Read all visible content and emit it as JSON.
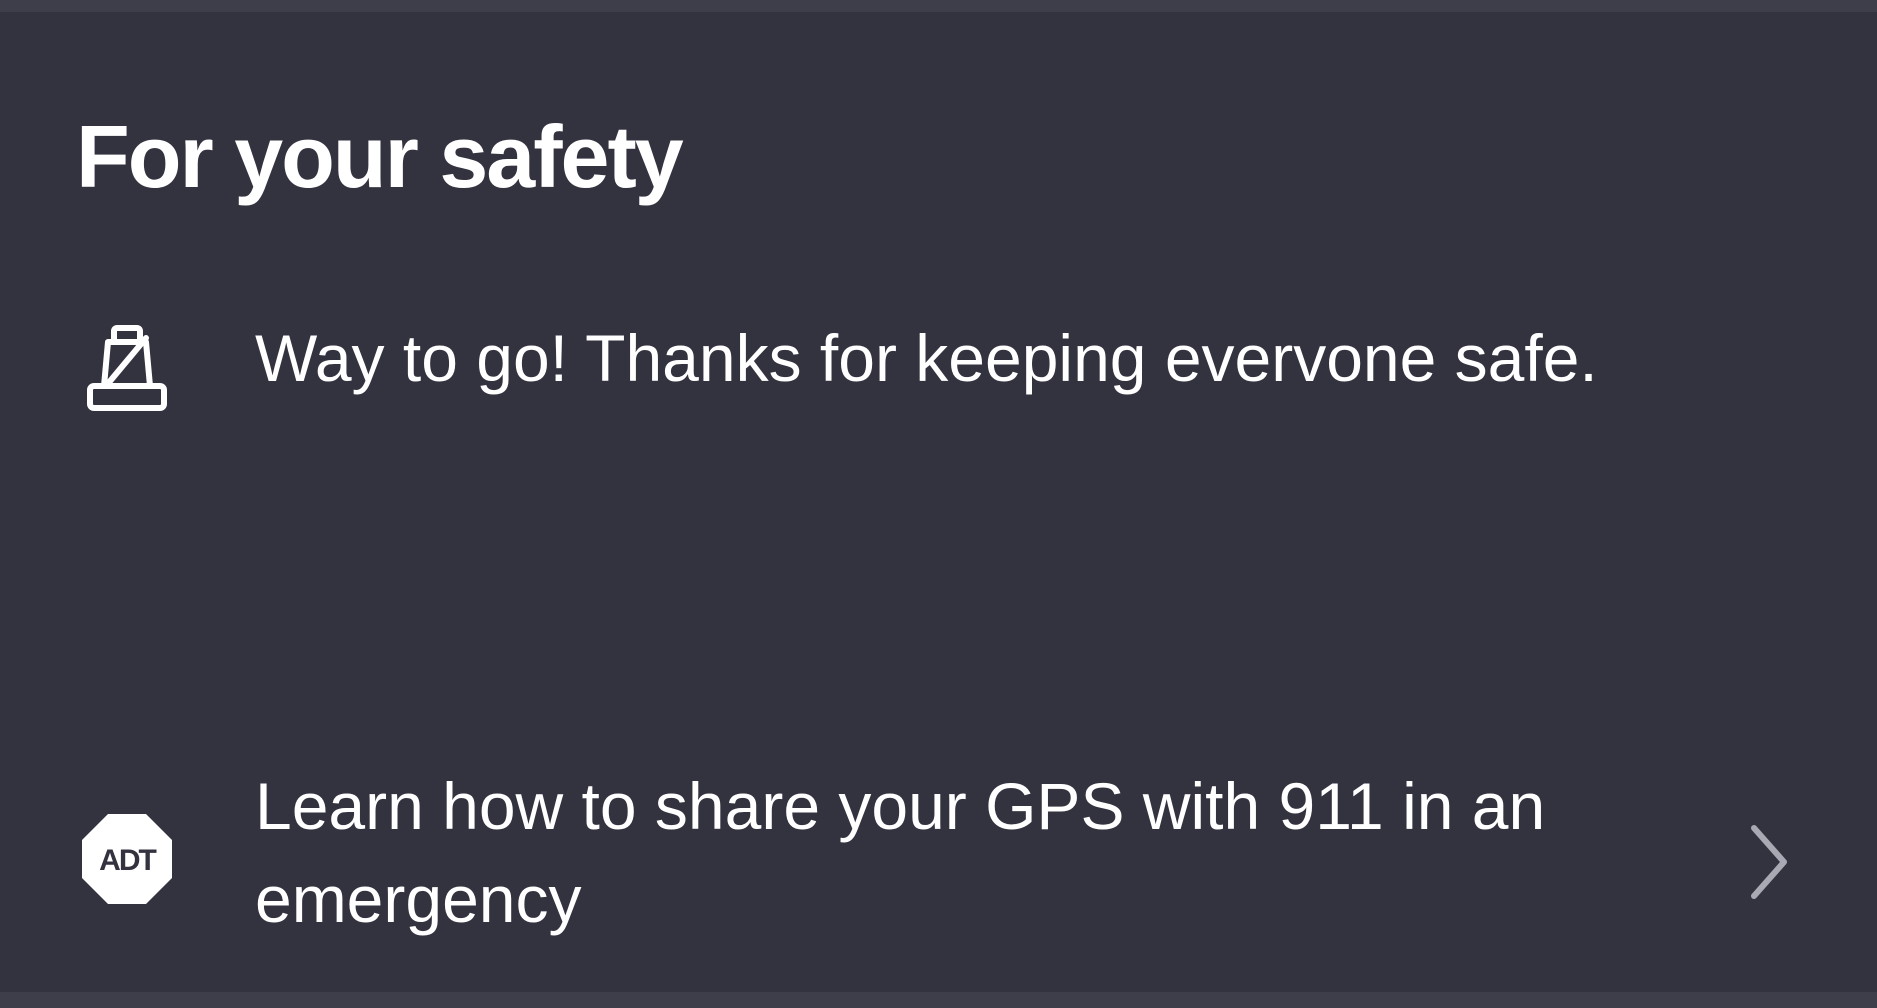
{
  "card": {
    "title": "For your safety",
    "praise": {
      "icon": "seatbelt-icon",
      "text": "Way to go! Thanks for keeping evervone safe."
    },
    "adt_link": {
      "icon": "adt-logo-icon",
      "logo_text": "ADT",
      "text": "Learn how to share your GPS with 911 in an emergency",
      "chevron_icon": "chevron-right-icon"
    }
  },
  "colors": {
    "background": "#33323f",
    "border": "#3e3e4a",
    "text": "#ffffff",
    "chevron": "#a9a9b3"
  }
}
